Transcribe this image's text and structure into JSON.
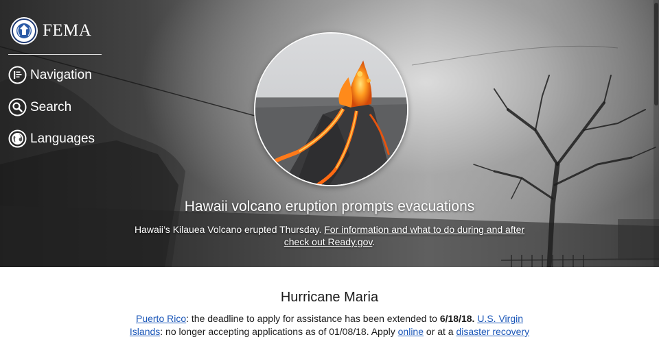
{
  "brand": {
    "name": "FEMA",
    "seal_icon": "dhs-seal-icon"
  },
  "nav": [
    {
      "label": "Navigation",
      "icon": "menu-lines-icon"
    },
    {
      "label": "Search",
      "icon": "magnifier-icon"
    },
    {
      "label": "Languages",
      "icon": "globe-icon"
    }
  ],
  "feature": {
    "image": "volcano-eruption-photo",
    "title": "Hawaii volcano eruption prompts evacuations",
    "body_text": "Hawaii’s Kilauea Volcano erupted Thursday. ",
    "body_link": "For information and what to do during and after check out Ready.gov",
    "body_end": "."
  },
  "notice": {
    "title": "Hurricane Maria",
    "link_pr": "Puerto Rico",
    "text1": ": the deadline to apply for assistance has been extended to ",
    "date": "6/18/18.",
    "link_usvi": "U.S. Virgin Islands",
    "text2": ": no longer accepting applications as of 01/08/18. Apply ",
    "link_online": "online",
    "text3": " or at a ",
    "link_drc": "disaster recovery"
  },
  "colors": {
    "link": "#1a56b8",
    "text": "#1b1b1b",
    "hero_text": "#ffffff"
  }
}
